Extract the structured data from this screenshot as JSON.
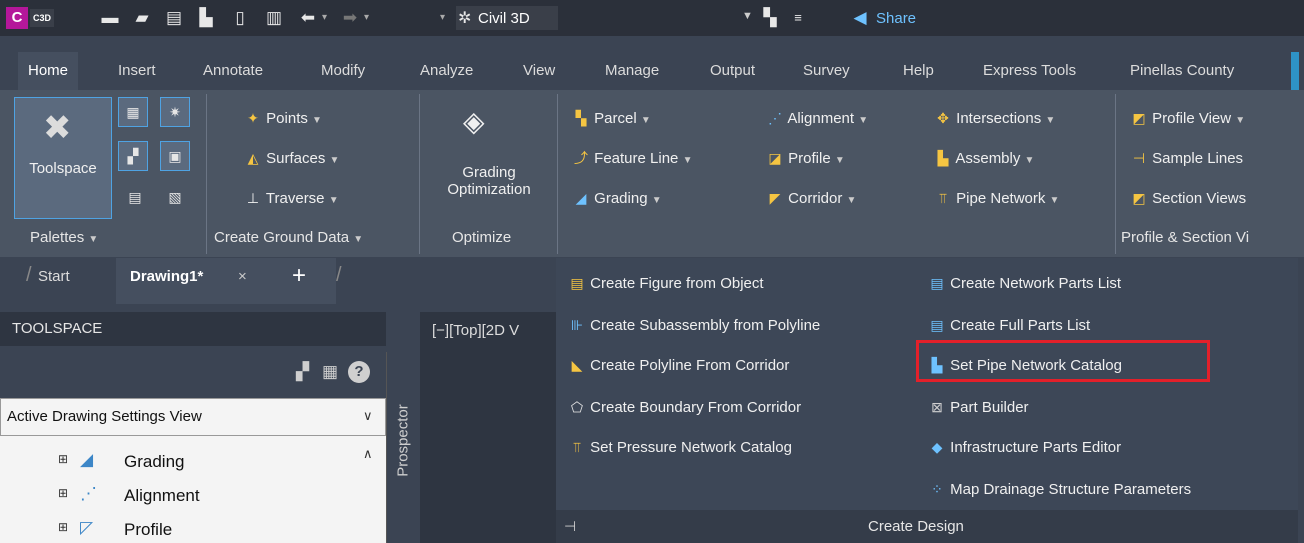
{
  "titlebar": {
    "app_letter": "C",
    "app_tag": "C3D",
    "workspace": "Civil 3D",
    "share": "Share"
  },
  "tabs": [
    "Home",
    "Insert",
    "Annotate",
    "Modify",
    "Analyze",
    "View",
    "Manage",
    "Output",
    "Survey",
    "Help",
    "Express Tools",
    "Pinellas County"
  ],
  "ribbon": {
    "palettes": {
      "toolspace": "Toolspace",
      "title": "Palettes"
    },
    "ground": {
      "points": "Points",
      "surfaces": "Surfaces",
      "traverse": "Traverse",
      "title": "Create Ground Data"
    },
    "optimize": {
      "line1": "Grading",
      "line2": "Optimization",
      "title": "Optimize"
    },
    "design": {
      "col1": [
        "Parcel",
        "Feature Line",
        "Grading"
      ],
      "col2": [
        "Alignment",
        "Profile",
        "Corridor"
      ],
      "col3": [
        "Intersections",
        "Assembly",
        "Pipe Network"
      ]
    },
    "profile_section": {
      "items": [
        "Profile View",
        "Sample Lines",
        "Section Views"
      ],
      "title": "Profile & Section Vi"
    }
  },
  "dropdown": {
    "left": [
      "Create Figure from Object",
      "Create Subassembly from Polyline",
      "Create Polyline From Corridor",
      "Create Boundary From Corridor",
      "Set Pressure Network Catalog"
    ],
    "right": [
      "Create Network Parts List",
      "Create Full Parts List",
      "Set Pipe Network Catalog",
      "Part Builder",
      "Infrastructure Parts Editor",
      "Map Drainage Structure Parameters"
    ],
    "title": "Create Design",
    "highlighted": "Set Pipe Network Catalog"
  },
  "doctabs": {
    "start": "Start",
    "drawing": "Drawing1*",
    "close": "×",
    "add": "+"
  },
  "toolspace": {
    "header": "TOOLSPACE",
    "view_select": "Active Drawing Settings View",
    "tree": [
      "Grading",
      "Alignment",
      "Profile"
    ],
    "side_tab": "Prospector"
  },
  "viewport": {
    "label": "[−][Top][2D V"
  },
  "colors": {
    "accent_blue": "#2e93c6",
    "highlight_red": "#e3202a",
    "app_magenta": "#b4179a"
  }
}
